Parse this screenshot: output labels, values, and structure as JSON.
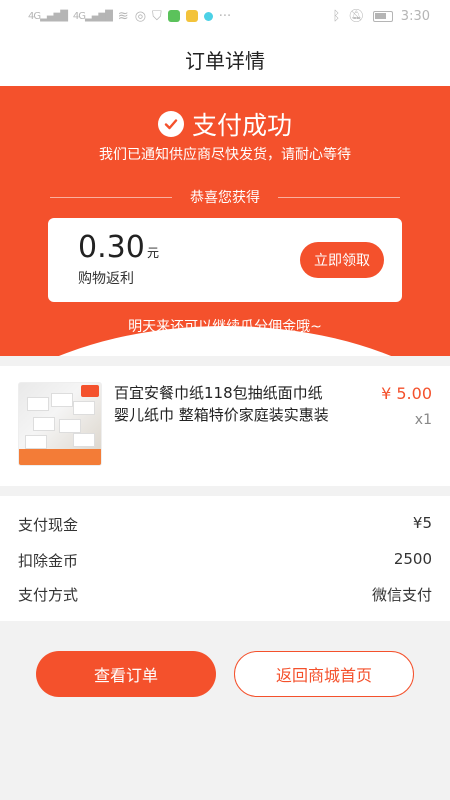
{
  "status_bar": {
    "carrier1": "4G",
    "carrier2": "4G",
    "time": "3:30",
    "more": "···"
  },
  "nav": {
    "title": "订单详情"
  },
  "success": {
    "title": "支付成功",
    "subtitle": "我们已通知供应商尽快发货，请耐心等待",
    "congrats": "恭喜您获得",
    "reward_amount": "0.30",
    "reward_unit": "元",
    "reward_label": "购物返利",
    "claim_label": "立即领取",
    "tomorrow_note": "明天来还可以继续瓜分佣金哦~"
  },
  "product": {
    "title": "百宜安餐巾纸118包抽纸面巾纸婴儿纸巾 整箱特价家庭装实惠装",
    "price": "¥ 5.00",
    "qty": "x1"
  },
  "summary": {
    "rows": [
      {
        "label": "支付现金",
        "value": "¥5"
      },
      {
        "label": "扣除金币",
        "value": "2500"
      },
      {
        "label": "支付方式",
        "value": "微信支付"
      }
    ]
  },
  "actions": {
    "view_order": "查看订单",
    "back_home": "返回商城首页"
  },
  "colors": {
    "accent": "#f4512c",
    "background": "#f2f2f2"
  }
}
